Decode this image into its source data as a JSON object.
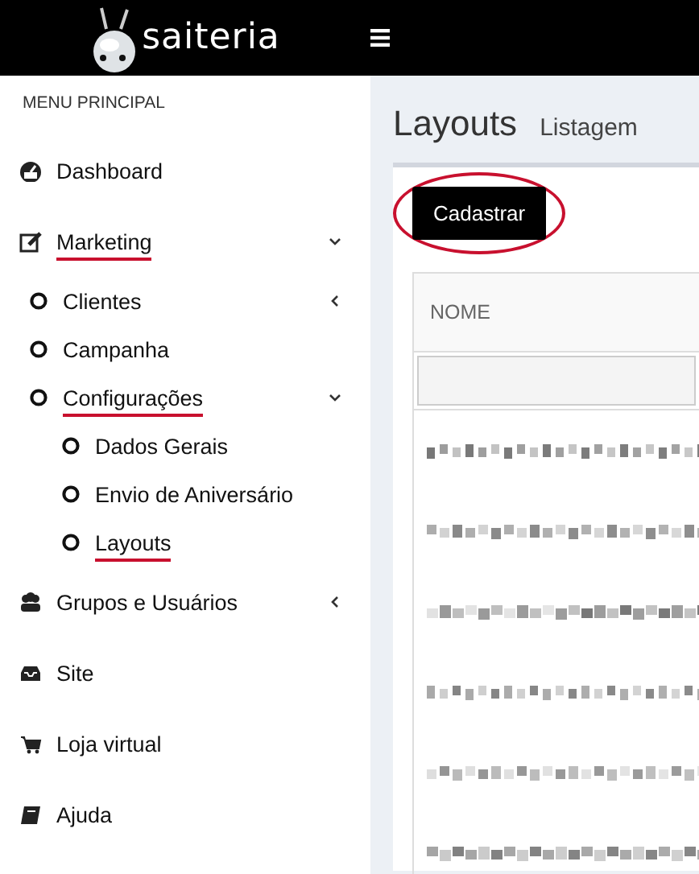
{
  "header": {
    "logo_text": "saiteria"
  },
  "sidebar": {
    "heading": "MENU PRINCIPAL",
    "items": [
      {
        "label": "Dashboard",
        "annotated": false
      },
      {
        "label": "Marketing",
        "annotated": true,
        "expanded": true,
        "children": [
          {
            "label": "Clientes",
            "annotated": false,
            "expanded": false
          },
          {
            "label": "Campanha",
            "annotated": false
          },
          {
            "label": "Configurações",
            "annotated": true,
            "expanded": true,
            "children": [
              {
                "label": "Dados Gerais",
                "annotated": false
              },
              {
                "label": "Envio de Aniversário",
                "annotated": false
              },
              {
                "label": "Layouts",
                "annotated": true
              }
            ]
          }
        ]
      },
      {
        "label": "Grupos e Usuários",
        "annotated": false,
        "expanded": false
      },
      {
        "label": "Site",
        "annotated": false
      },
      {
        "label": "Loja virtual",
        "annotated": false
      },
      {
        "label": "Ajuda",
        "annotated": false
      }
    ]
  },
  "page": {
    "title": "Layouts",
    "subtitle": "Listagem",
    "button": {
      "label": "Cadastrar",
      "circled": true
    },
    "table": {
      "columns": [
        "NOME"
      ],
      "rows": [
        {
          "kind": "pixelated"
        },
        {
          "kind": "pixelated"
        },
        {
          "kind": "pixelated"
        },
        {
          "kind": "pixelated"
        },
        {
          "kind": "pixelated"
        },
        {
          "kind": "pixelated"
        }
      ]
    }
  }
}
